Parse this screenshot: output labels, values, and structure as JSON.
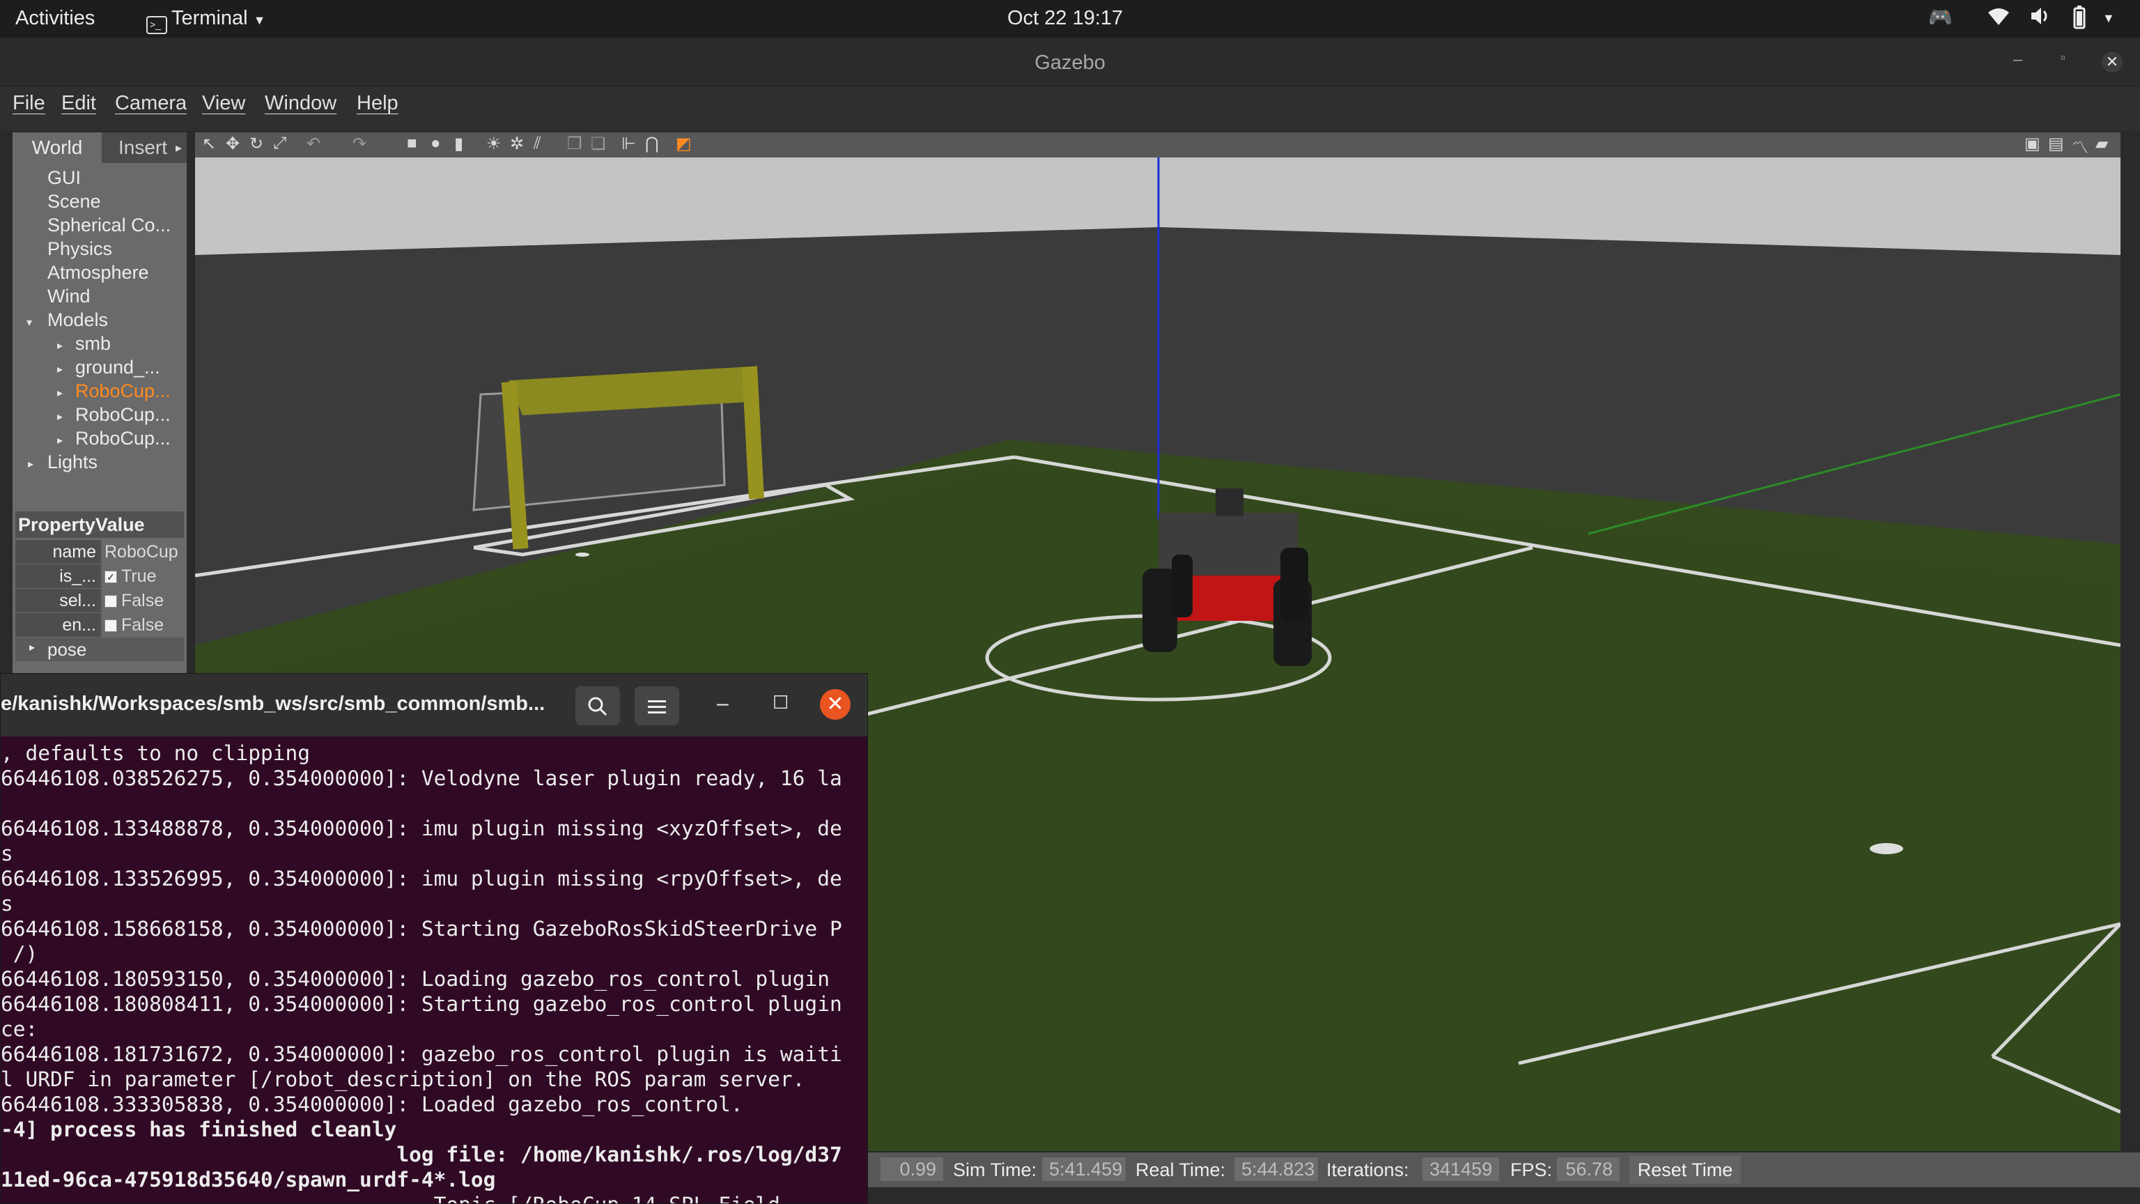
{
  "topbar": {
    "activities": "Activities",
    "app_label": "Terminal",
    "clock": "Oct 22  19:17"
  },
  "gazebo": {
    "window_title": "Gazebo",
    "menu": [
      "File",
      "Edit",
      "Camera",
      "View",
      "Window",
      "Help"
    ],
    "tabs": {
      "world": "World",
      "insert": "Insert"
    },
    "tree": {
      "gui": "GUI",
      "scene": "Scene",
      "spherical": "Spherical Co...",
      "physics": "Physics",
      "atmosphere": "Atmosphere",
      "wind": "Wind",
      "models": "Models",
      "model_smb": "smb",
      "model_ground": "ground_...",
      "model_robocup1": "RoboCup...",
      "model_robocup2": "RoboCup...",
      "model_robocup3": "RoboCup...",
      "lights": "Lights"
    },
    "properties": {
      "header": "PropertyValue",
      "rows": [
        {
          "key": "name",
          "value": "RoboCup"
        },
        {
          "key": "is_...",
          "value": "True",
          "checked": true
        },
        {
          "key": "sel...",
          "value": "False",
          "checked": false
        },
        {
          "key": "en...",
          "value": "False",
          "checked": false
        }
      ],
      "pose": "pose"
    },
    "status": {
      "rtf_value": "0.99",
      "sim_time_label": "Sim Time:",
      "sim_time_value": "5:41.459",
      "real_time_label": "Real Time:",
      "real_time_value": "5:44.823",
      "iterations_label": "Iterations:",
      "iterations_value": "341459",
      "fps_label": "FPS:",
      "fps_value": "56.78",
      "reset_button": "Reset Time"
    }
  },
  "terminal": {
    "path": "e/kanishk/Workspaces/smb_ws/src/smb_common/smb...",
    "lines": [
      ", defaults to no clipping",
      "66446108.038526275, 0.354000000]: Velodyne laser plugin ready, 16 la",
      "",
      "66446108.133488878, 0.354000000]: imu plugin missing <xyzOffset>, de",
      "s",
      "66446108.133526995, 0.354000000]: imu plugin missing <rpyOffset>, de",
      "s",
      "66446108.158668158, 0.354000000]: Starting GazeboRosSkidSteerDrive P",
      " /)",
      "66446108.180593150, 0.354000000]: Loading gazebo_ros_control plugin",
      "66446108.180808411, 0.354000000]: Starting gazebo_ros_control plugin",
      "ce:",
      "66446108.181731672, 0.354000000]: gazebo_ros_control plugin is waiti",
      "l URDF in parameter [/robot_description] on the ROS param server.",
      "66446108.333305838, 0.354000000]: Loaded gazebo_ros_control.",
      "-4] process has finished cleanly",
      "                                log file: /home/kanishk/.ros/log/d37",
      "11ed-96ca-475918d35640/spawn_urdf-4*.log",
      "                                   Topic [/RoboCup_14_SPL_Field"
    ],
    "bold_lines": [
      15,
      16,
      17
    ]
  }
}
